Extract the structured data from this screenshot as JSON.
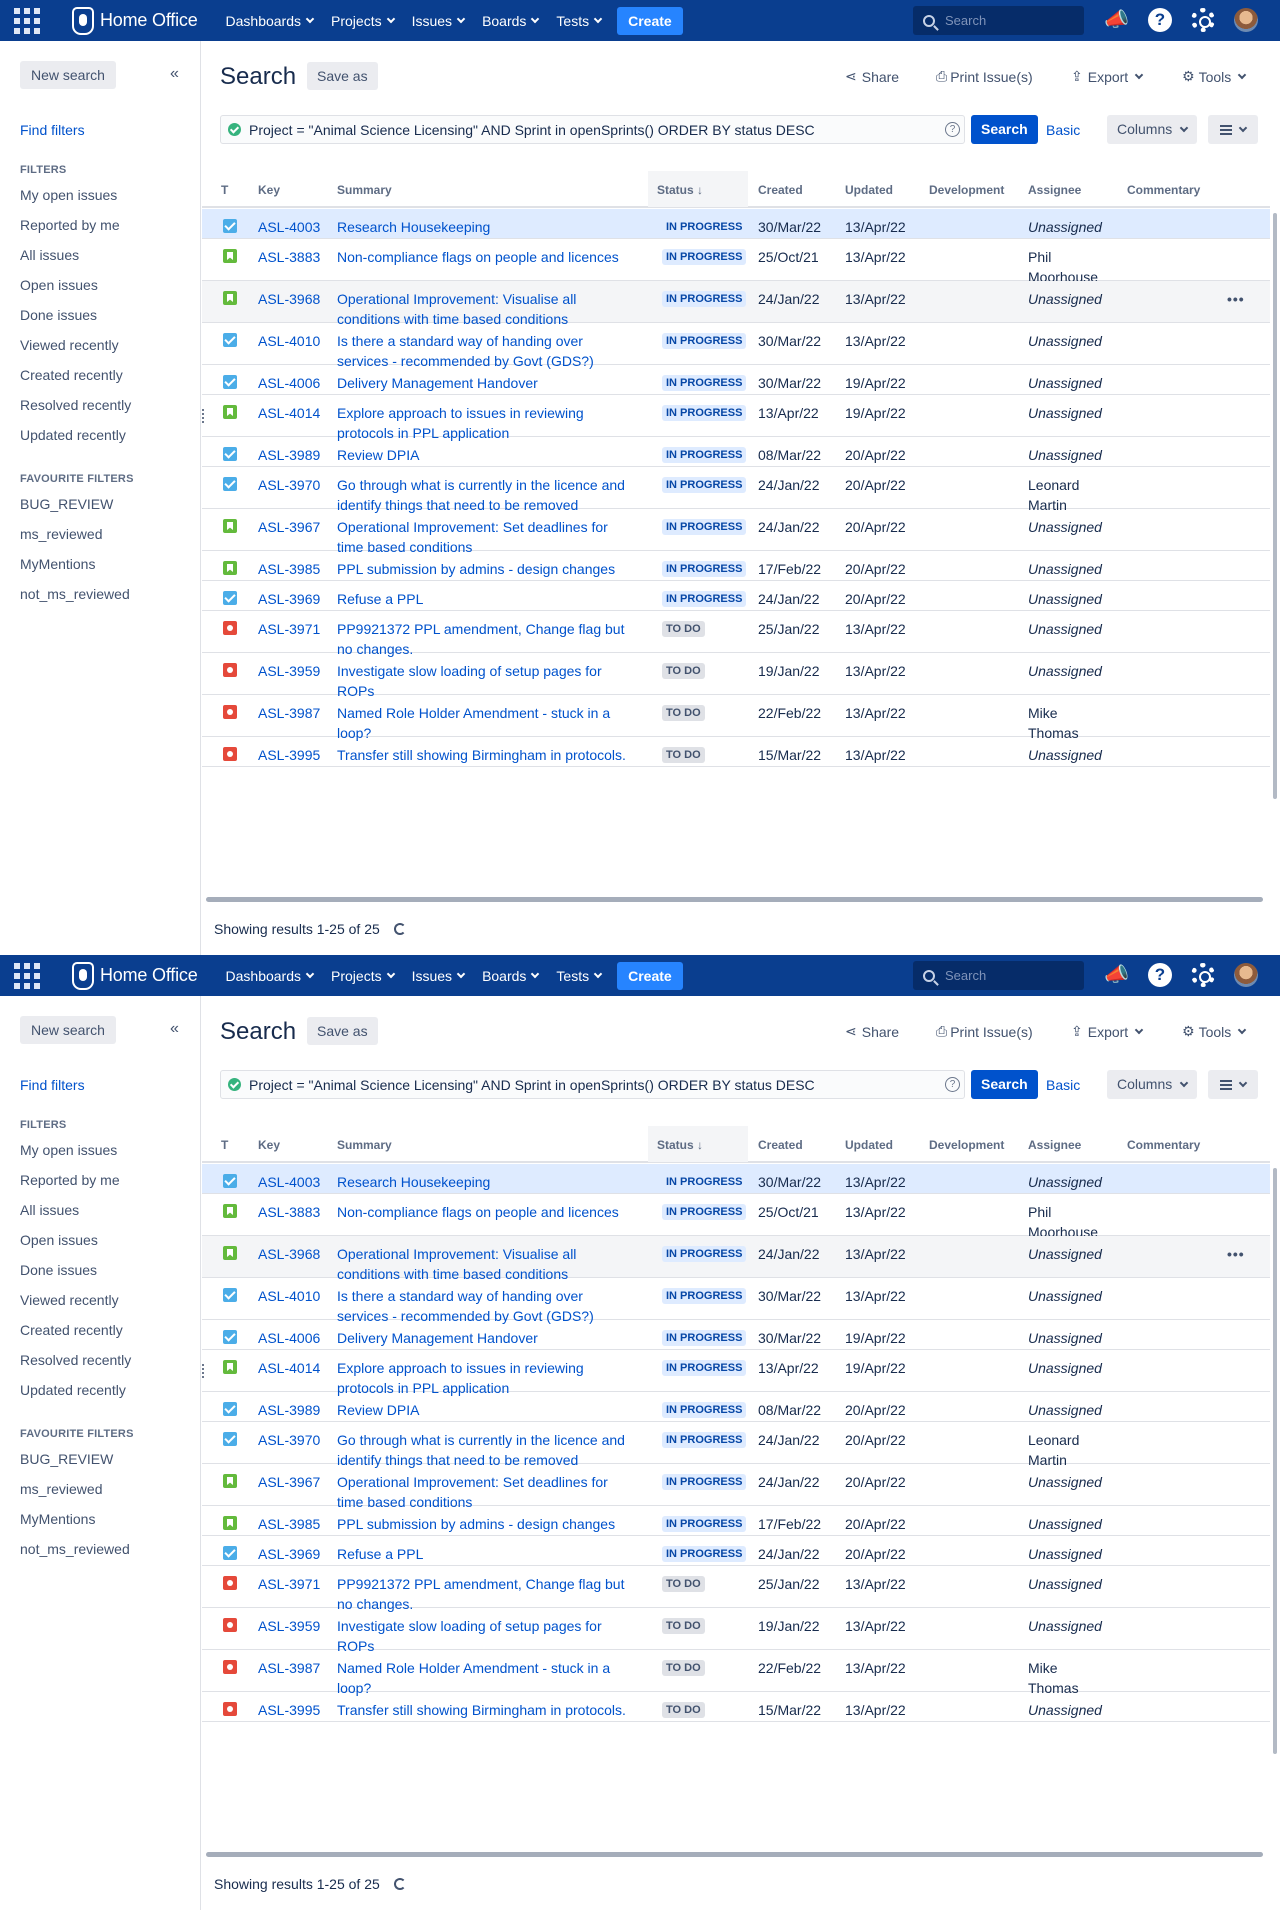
{
  "topnav": {
    "brand": "Home Office",
    "menu": [
      {
        "label": "Dashboards"
      },
      {
        "label": "Projects"
      },
      {
        "label": "Issues"
      },
      {
        "label": "Boards"
      },
      {
        "label": "Tests"
      }
    ],
    "create": "Create",
    "search_placeholder": "Search",
    "help_glyph": "?"
  },
  "sidebar": {
    "new_search": "New search",
    "collapse_glyph": "«",
    "find_filters": "Find filters",
    "filters_heading": "FILTERS",
    "filters": [
      {
        "label": "My open issues"
      },
      {
        "label": "Reported by me"
      },
      {
        "label": "All issues"
      },
      {
        "label": "Open issues"
      },
      {
        "label": "Done issues"
      },
      {
        "label": "Viewed recently"
      },
      {
        "label": "Created recently"
      },
      {
        "label": "Resolved recently"
      },
      {
        "label": "Updated recently"
      }
    ],
    "favourites_heading": "FAVOURITE FILTERS",
    "favourites": [
      {
        "label": "BUG_REVIEW"
      },
      {
        "label": "ms_reviewed"
      },
      {
        "label": "MyMentions"
      },
      {
        "label": "not_ms_reviewed"
      }
    ]
  },
  "main": {
    "title": "Search",
    "save_as": "Save as",
    "share": "Share",
    "print": "Print Issue(s)",
    "export": "Export",
    "tools": "Tools",
    "query": "Project = \"Animal Science Licensing\"  AND Sprint in openSprints() ORDER BY status DESC",
    "query_help_glyph": "?",
    "search_button": "Search",
    "basic": "Basic",
    "columns": "Columns",
    "headers": {
      "type": "T",
      "key": "Key",
      "summary": "Summary",
      "status": "Status",
      "sort_glyph": "↓",
      "created": "Created",
      "updated": "Updated",
      "development": "Development",
      "assignee": "Assignee",
      "commentary": "Commentary"
    },
    "row_more_glyph": "•••",
    "results": "Showing results 1-25 of 25"
  },
  "issues": [
    {
      "type": "task",
      "key": "ASL-4003",
      "summary": [
        "Research Housekeeping"
      ],
      "status": "IN PROGRESS",
      "created": "30/Mar/22",
      "updated": "13/Apr/22",
      "assignee": [
        "Unassigned"
      ]
    },
    {
      "type": "story",
      "key": "ASL-3883",
      "summary": [
        "Non-compliance flags on people and licences"
      ],
      "status": "IN PROGRESS",
      "created": "25/Oct/21",
      "updated": "13/Apr/22",
      "assignee": [
        "Phil",
        "Moorhouse"
      ]
    },
    {
      "type": "story",
      "key": "ASL-3968",
      "summary": [
        "Operational Improvement: Visualise all",
        "conditions with time based conditions"
      ],
      "status": "IN PROGRESS",
      "created": "24/Jan/22",
      "updated": "13/Apr/22",
      "assignee": [
        "Unassigned"
      ]
    },
    {
      "type": "task",
      "key": "ASL-4010",
      "summary": [
        "Is there a standard way of handing over",
        "services - recommended by Govt (GDS?)"
      ],
      "status": "IN PROGRESS",
      "created": "30/Mar/22",
      "updated": "13/Apr/22",
      "assignee": [
        "Unassigned"
      ]
    },
    {
      "type": "task",
      "key": "ASL-4006",
      "summary": [
        "Delivery Management Handover"
      ],
      "status": "IN PROGRESS",
      "created": "30/Mar/22",
      "updated": "19/Apr/22",
      "assignee": [
        "Unassigned"
      ]
    },
    {
      "type": "story",
      "key": "ASL-4014",
      "summary": [
        "Explore approach to issues in reviewing",
        "protocols in PPL application"
      ],
      "status": "IN PROGRESS",
      "created": "13/Apr/22",
      "updated": "19/Apr/22",
      "assignee": [
        "Unassigned"
      ]
    },
    {
      "type": "task",
      "key": "ASL-3989",
      "summary": [
        "Review DPIA"
      ],
      "status": "IN PROGRESS",
      "created": "08/Mar/22",
      "updated": "20/Apr/22",
      "assignee": [
        "Unassigned"
      ]
    },
    {
      "type": "task",
      "key": "ASL-3970",
      "summary": [
        "Go through what is currently in the licence and",
        "identify things that need to be removed"
      ],
      "status": "IN PROGRESS",
      "created": "24/Jan/22",
      "updated": "20/Apr/22",
      "assignee": [
        "Leonard",
        "Martin"
      ]
    },
    {
      "type": "story",
      "key": "ASL-3967",
      "summary": [
        "Operational Improvement: Set deadlines for",
        "time based conditions"
      ],
      "status": "IN PROGRESS",
      "created": "24/Jan/22",
      "updated": "20/Apr/22",
      "assignee": [
        "Unassigned"
      ]
    },
    {
      "type": "story",
      "key": "ASL-3985",
      "summary": [
        "PPL submission by admins - design changes"
      ],
      "status": "IN PROGRESS",
      "created": "17/Feb/22",
      "updated": "20/Apr/22",
      "assignee": [
        "Unassigned"
      ]
    },
    {
      "type": "task",
      "key": "ASL-3969",
      "summary": [
        "Refuse a PPL"
      ],
      "status": "IN PROGRESS",
      "created": "24/Jan/22",
      "updated": "20/Apr/22",
      "assignee": [
        "Unassigned"
      ]
    },
    {
      "type": "bug",
      "key": "ASL-3971",
      "summary": [
        "PP9921372 PPL amendment, Change flag but",
        "no changes."
      ],
      "status": "TO DO",
      "created": "25/Jan/22",
      "updated": "13/Apr/22",
      "assignee": [
        "Unassigned"
      ]
    },
    {
      "type": "bug",
      "key": "ASL-3959",
      "summary": [
        "Investigate slow loading of setup pages for",
        "ROPs"
      ],
      "status": "TO DO",
      "created": "19/Jan/22",
      "updated": "13/Apr/22",
      "assignee": [
        "Unassigned"
      ]
    },
    {
      "type": "bug",
      "key": "ASL-3987",
      "summary": [
        "Named Role Holder Amendment - stuck in a",
        "loop?"
      ],
      "status": "TO DO",
      "created": "22/Feb/22",
      "updated": "13/Apr/22",
      "assignee": [
        "Mike",
        "Thomas"
      ]
    },
    {
      "type": "bug",
      "key": "ASL-3995",
      "summary": [
        "Transfer still showing Birmingham in protocols."
      ],
      "status": "TO DO",
      "created": "15/Mar/22",
      "updated": "13/Apr/22",
      "assignee": [
        "Unassigned"
      ]
    }
  ],
  "colors": {
    "nav": "#0a3e8f",
    "create": "#2684ff",
    "link": "#0052cc",
    "selected_row": "#deebff"
  }
}
